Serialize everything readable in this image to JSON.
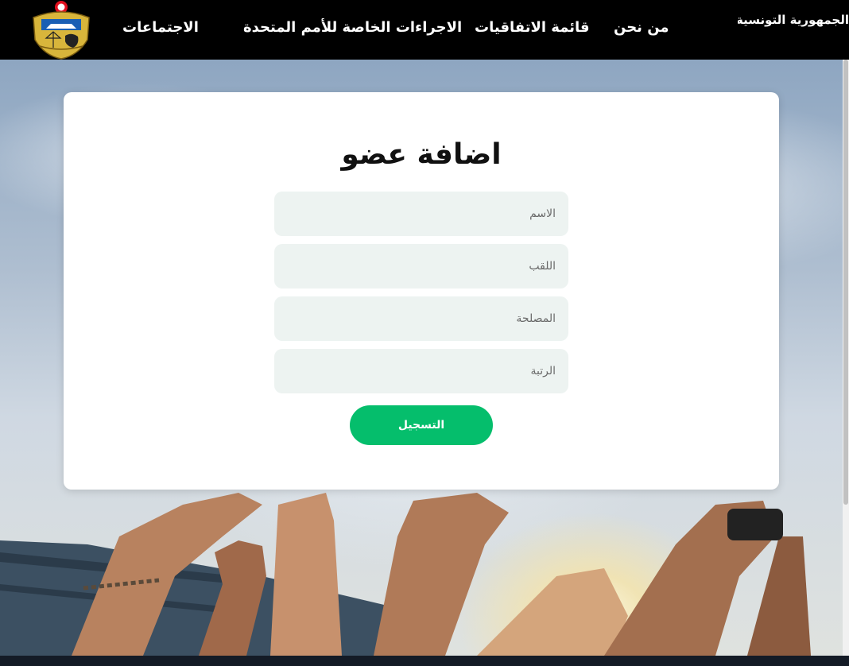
{
  "header": {
    "brand": "الجمهورية التونسية | رئاسة الحكومة",
    "nav": {
      "about": "من نحن",
      "agreements": "قائمة الاتفاقيات",
      "un_procedures": "الاجراءات الخاصة للأمم المتحدة",
      "meetings": "الاجتماعات"
    }
  },
  "form": {
    "title": "اضافة عضو",
    "fields": {
      "name": {
        "placeholder": "الاسم",
        "value": ""
      },
      "surname": {
        "placeholder": "اللقب",
        "value": ""
      },
      "department": {
        "placeholder": "المصلحة",
        "value": ""
      },
      "rank": {
        "placeholder": "الرتبة",
        "value": ""
      }
    },
    "submit_label": "التسجيل"
  },
  "colors": {
    "header_bg": "#000000",
    "accent_green": "#05be6c",
    "field_bg": "#edf3f1"
  }
}
